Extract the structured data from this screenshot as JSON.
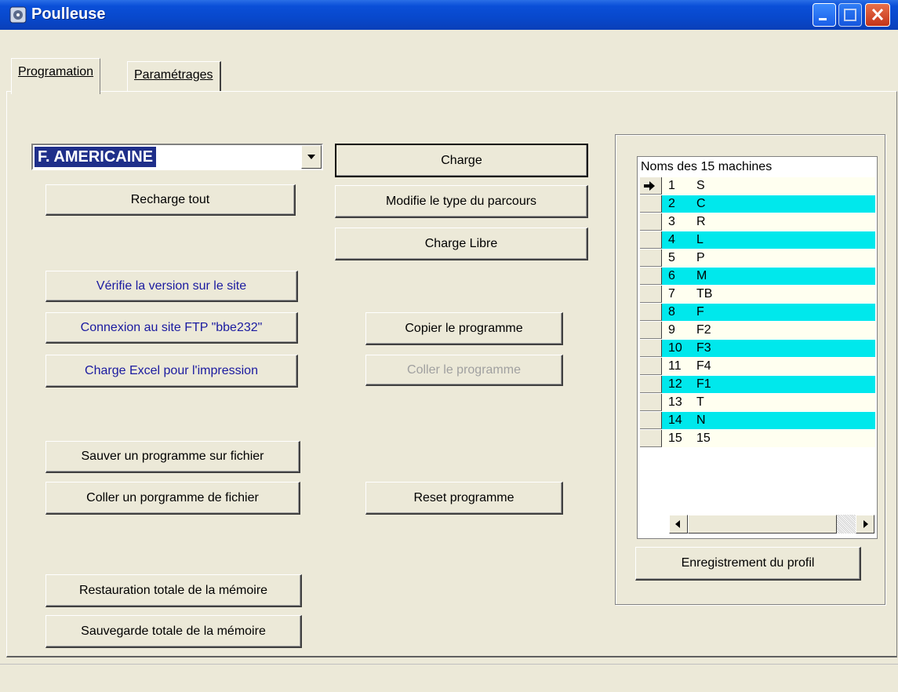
{
  "window": {
    "title": "Poulleuse"
  },
  "tabs": [
    {
      "label": "Programation",
      "active": true
    },
    {
      "label": "Paramétrages",
      "active": false
    }
  ],
  "combo": {
    "value": "F. AMERICAINE"
  },
  "buttons": {
    "recharge_tout": "Recharge tout",
    "charge": "Charge",
    "modifie_type": "Modifie le type du parcours",
    "charge_libre": "Charge Libre",
    "verifie_version": "Vérifie la version sur le site",
    "connexion_ftp": "Connexion au site FTP  \"bbe232\"",
    "charge_excel": "Charge Excel pour l'impression",
    "copier_programme": "Copier le programme",
    "coller_programme": "Coller le programme",
    "sauver_programme": "Sauver un programme sur fichier",
    "coller_porgramme_fichier": "Coller un porgramme de fichier",
    "reset_programme": "Reset programme",
    "restauration": "Restauration totale de la mémoire",
    "sauvegarde": "Sauvegarde totale de la mémoire",
    "enregistrement_profil": "Enregistrement du profil"
  },
  "grid": {
    "caption": "Noms des 15 machines",
    "rows": [
      {
        "num": "1",
        "name": "S"
      },
      {
        "num": "2",
        "name": "C"
      },
      {
        "num": "3",
        "name": "R"
      },
      {
        "num": "4",
        "name": "L"
      },
      {
        "num": "5",
        "name": "P"
      },
      {
        "num": "6",
        "name": "M"
      },
      {
        "num": "7",
        "name": "TB"
      },
      {
        "num": "8",
        "name": "F"
      },
      {
        "num": "9",
        "name": "F2"
      },
      {
        "num": "10",
        "name": "F3"
      },
      {
        "num": "11",
        "name": "F4"
      },
      {
        "num": "12",
        "name": "F1"
      },
      {
        "num": "13",
        "name": "T"
      },
      {
        "num": "14",
        "name": "N"
      },
      {
        "num": "15",
        "name": "15"
      }
    ]
  },
  "colors": {
    "title_bar": "#0848cc",
    "row_highlight": "#00e8ec",
    "combo_selection": "#1f2f8a"
  }
}
